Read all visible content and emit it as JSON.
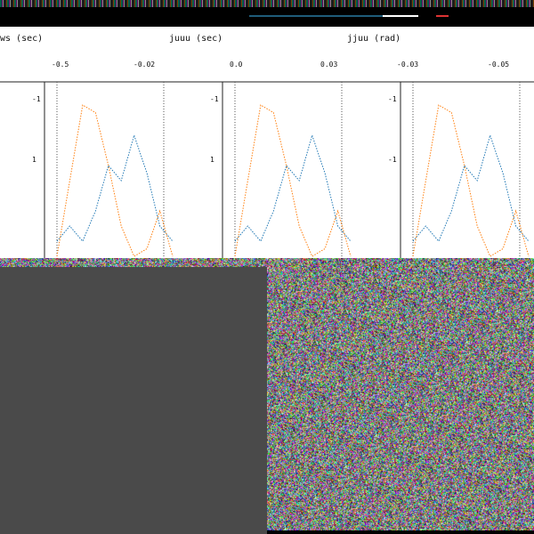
{
  "subplot_titles": [
    "ws (sec)",
    "juuu (sec)",
    "jjuu (rad)",
    ""
  ],
  "tick_labels": {
    "axis_values": [
      "-0.5",
      "-0.02",
      "0.0",
      "0.03",
      "-0.03",
      "-0.05"
    ],
    "y_ticks": [
      "-1",
      "1",
      "-1",
      "1",
      "-1",
      "-1"
    ]
  },
  "colors": {
    "series_a": "#1f77b4",
    "series_b": "#ff7f0e",
    "background": "#ffffff",
    "grey_block": "#4a4a4a"
  },
  "chart_data": {
    "type": "line",
    "series": [
      {
        "values": [
          0.1,
          0.2,
          0.1,
          0.3,
          0.6,
          0.5,
          0.8,
          0.55,
          0.2,
          0.1
        ]
      },
      {
        "values": [
          0.0,
          0.5,
          1.0,
          0.95,
          0.6,
          0.2,
          0.0,
          0.05,
          0.3,
          0.0
        ]
      }
    ]
  }
}
